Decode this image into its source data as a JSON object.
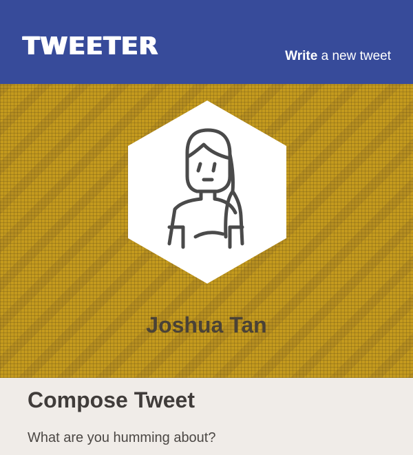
{
  "nav": {
    "brand": "TWEETER",
    "write_bold": "Write",
    "write_rest": "a new tweet"
  },
  "profile": {
    "name": "Joshua Tan",
    "avatar_icon": "user-avatar-icon"
  },
  "compose": {
    "title": "Compose Tweet",
    "placeholder": "What are you humming about?"
  },
  "colors": {
    "nav_bg": "#374b9a",
    "hero_bg": "#c49a1e",
    "compose_bg": "#f0ece8",
    "name_text": "#4a4236"
  }
}
